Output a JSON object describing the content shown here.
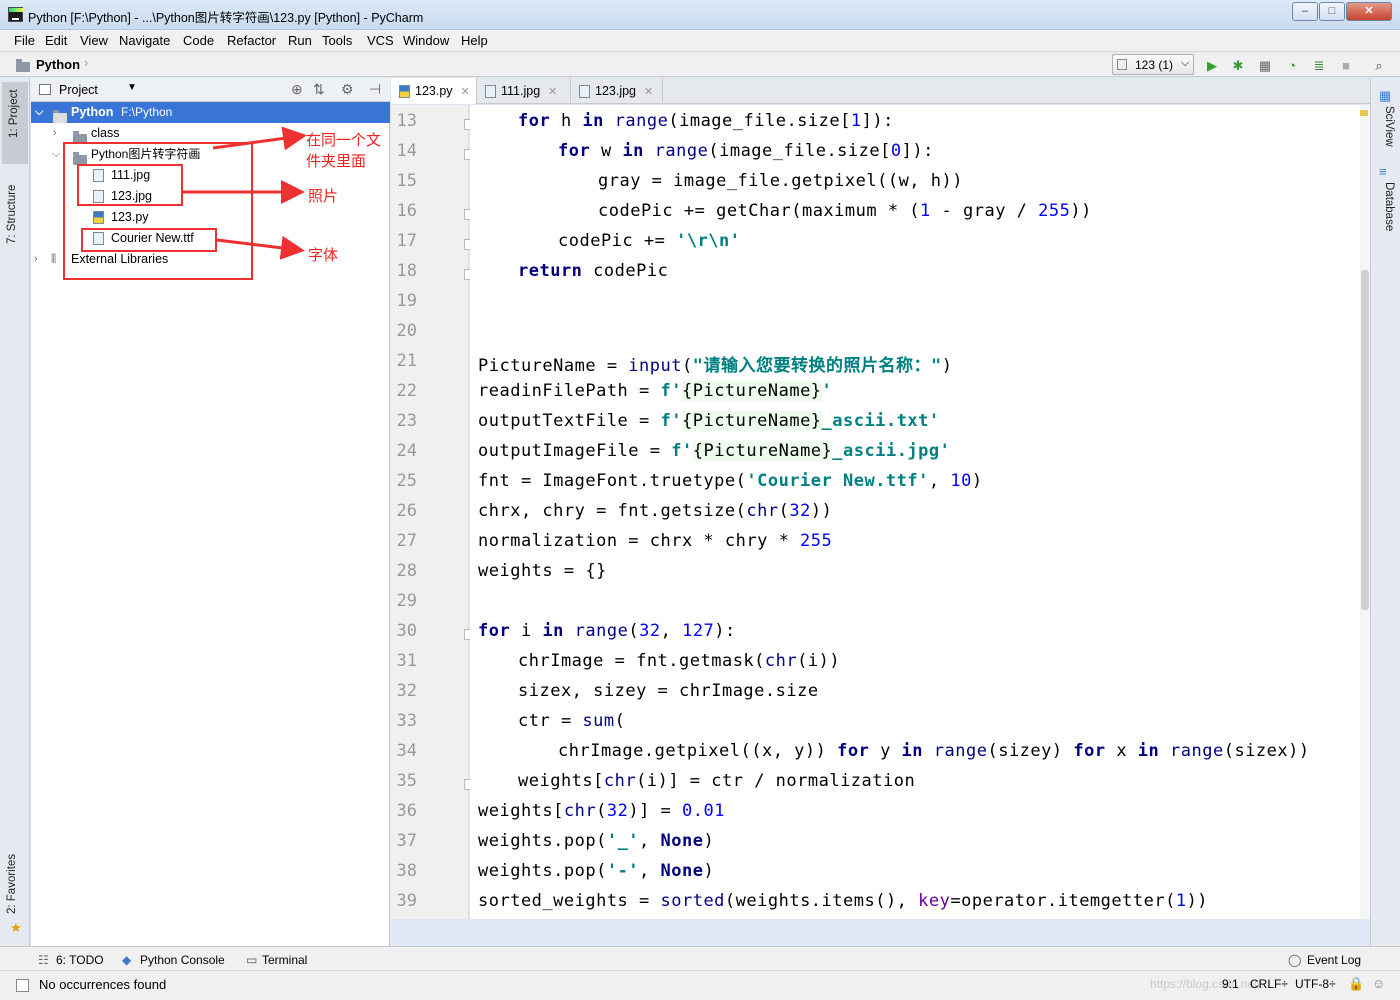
{
  "window": {
    "title": "Python [F:\\Python] - ...\\Python图片转字符画\\123.py [Python] - PyCharm",
    "minimize": "–",
    "maximize": "□",
    "close": "✕"
  },
  "menu": [
    "File",
    "Edit",
    "View",
    "Navigate",
    "Code",
    "Refactor",
    "Run",
    "Tools",
    "VCS",
    "Window",
    "Help"
  ],
  "navbar": {
    "breadcrumb": "Python",
    "run_config": "123 (1)"
  },
  "left_strip": {
    "project": "1: Project",
    "structure": "7: Structure",
    "favorites": "2: Favorites"
  },
  "right_strip": {
    "sciview": "SciView",
    "database": "Database"
  },
  "project": {
    "header": "Project",
    "root": {
      "name": "Python",
      "path": "F:\\Python"
    },
    "items": [
      {
        "label": "class"
      },
      {
        "label": "Python图片转字符画"
      },
      {
        "label": "111.jpg"
      },
      {
        "label": "123.jpg"
      },
      {
        "label": "123.py"
      },
      {
        "label": "Courier New.ttf"
      },
      {
        "label": "External Libraries"
      }
    ]
  },
  "annotations": {
    "same_folder": "在同一个文件夹里面",
    "photos": "照片",
    "font": "字体",
    "color": "#ee3030"
  },
  "tabs": [
    {
      "label": "123.py",
      "active": true
    },
    {
      "label": "111.jpg",
      "active": false
    },
    {
      "label": "123.jpg",
      "active": false
    }
  ],
  "code": {
    "line_numbers": [
      "13",
      "14",
      "15",
      "16",
      "17",
      "18",
      "19",
      "20",
      "21",
      "22",
      "23",
      "24",
      "25",
      "26",
      "27",
      "28",
      "29",
      "30",
      "31",
      "32",
      "33",
      "34",
      "35",
      "36",
      "37",
      "38",
      "39"
    ],
    "prompt_string": "\"请输入您要转换的照片名称：\"",
    "font_file": "'Courier New.ttf'"
  },
  "bottom_tabs": {
    "todo": "6: TODO",
    "console": "Python Console",
    "terminal": "Terminal",
    "event_log": "Event Log"
  },
  "status": {
    "message": "No occurrences found",
    "position": "9:1",
    "line_sep": "CRLF÷",
    "encoding": "UTF-8÷",
    "watermark": "https://blog.csdn.net/..."
  }
}
